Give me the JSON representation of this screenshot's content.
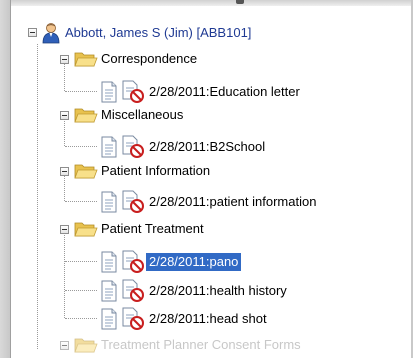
{
  "patient": {
    "label": "Abbott, James S (Jim) [ABB101]",
    "icon": "person-icon"
  },
  "folders": [
    {
      "label": "Correspondence",
      "items": [
        {
          "label": "2/28/2011:Education letter"
        }
      ]
    },
    {
      "label": "Miscellaneous",
      "items": [
        {
          "label": "2/28/2011:B2School"
        }
      ]
    },
    {
      "label": "Patient Information",
      "items": [
        {
          "label": "2/28/2011:patient information"
        }
      ]
    },
    {
      "label": "Patient Treatment",
      "items": [
        {
          "label": "2/28/2011:pano",
          "selected": true
        },
        {
          "label": "2/28/2011:health history"
        },
        {
          "label": "2/28/2011:head shot"
        }
      ]
    },
    {
      "label": "Treatment Planner Consent Forms",
      "items": []
    }
  ],
  "colors": {
    "selection": "#316ac5",
    "person_text": "#1f3a93",
    "folder": "#f4d76a"
  }
}
